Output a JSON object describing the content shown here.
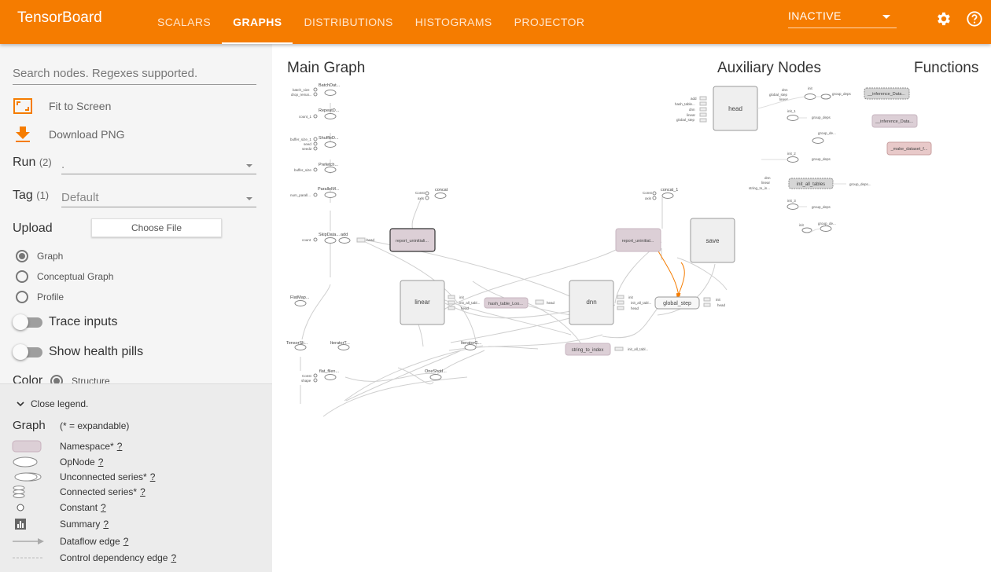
{
  "app": {
    "title": "TensorBoard"
  },
  "tabs": [
    "SCALARS",
    "GRAPHS",
    "DISTRIBUTIONS",
    "HISTOGRAMS",
    "PROJECTOR"
  ],
  "run_status": "INACTIVE",
  "icons": {
    "settings": "gear-icon",
    "help": "help-icon"
  },
  "colors": {
    "accent": "#f57c00",
    "namespace_fill": "#dccfd6",
    "opnode_fill": "#ffffff",
    "node_stroke": "#999999"
  },
  "sidebar": {
    "search_placeholder": "Search nodes. Regexes supported.",
    "fit_to_screen": "Fit to Screen",
    "download_png": "Download PNG",
    "run_label": "Run",
    "run_count": "(2)",
    "run_value": ".",
    "tag_label": "Tag",
    "tag_count": "(1)",
    "tag_value": "Default",
    "upload_label": "Upload",
    "choose_file": "Choose File",
    "graph_types": [
      "Graph",
      "Conceptual Graph",
      "Profile"
    ],
    "trace_inputs": "Trace inputs",
    "health_pills": "Show health pills",
    "color_label": "Color",
    "color_option": "Structure"
  },
  "legend": {
    "close": "Close legend.",
    "title": "Graph",
    "note": "(* = expandable)",
    "help_mark": "?",
    "items": [
      {
        "label": "Namespace*"
      },
      {
        "label": "OpNode"
      },
      {
        "label": "Unconnected series*"
      },
      {
        "label": "Connected series*"
      },
      {
        "label": "Constant"
      },
      {
        "label": "Summary"
      },
      {
        "label": "Dataflow edge"
      },
      {
        "label": "Control dependency edge"
      }
    ]
  },
  "graph": {
    "main_title": "Main Graph",
    "aux_title": "Auxiliary Nodes",
    "functions_title": "Functions",
    "main_nodes": {
      "linear": "linear",
      "dnn": "dnn",
      "save": "save",
      "global_step": "global_step",
      "hash_table": "hash_table_Loo...",
      "string_to_index": "string_to_index",
      "report_1": "report_uninitiali...",
      "report_2": "report_uninitial...",
      "batch": "BatchDat...",
      "repeat": "RepeatD...",
      "shuffle": "ShuffleD...",
      "prefetch": "Prefetch...",
      "parallel": "ParallelM...",
      "skip": "SkipData...",
      "add": "add",
      "flatmap": "FlatMap...",
      "tensorslice": "TensorSli...",
      "iteratort": "IteratorT...",
      "iteratorg": "IteratorG...",
      "oneshot": "OneShotI...",
      "flat_filen": "flat_filen...",
      "concat": "concat",
      "concat_1": "concat_1",
      "head": "head",
      "init": "init",
      "init_all_tables": "init_all_tabl...",
      "small_labels": [
        "batch_size",
        "drop_remai...",
        "count_1",
        "buffer_size_1",
        "seed",
        "seed2",
        "buffer_size",
        "num_parall...",
        "count",
        "Const",
        "axis",
        "Const",
        "axis",
        "Const",
        "shape"
      ]
    },
    "aux_nodes": {
      "head": "head",
      "head_inputs": [
        "add",
        "hash_table...",
        "dnn",
        "linear",
        "global_step"
      ],
      "init": "init",
      "init_inputs": [
        "dnn",
        "global_step",
        "linear"
      ],
      "group_deps": "group_deps",
      "init_1": "init_1",
      "init_2": "init_2",
      "init_3": "init_3",
      "init_all_tables": "init_all_tables",
      "iat_inputs": [
        "dnn",
        "linear",
        "string_to_in..."
      ],
      "group_de": "group_de...",
      "group_deps_short": "group_deps..."
    },
    "functions": [
      "__inference_Data...",
      "__inference_Data...",
      "_make_dataset_f..."
    ]
  }
}
